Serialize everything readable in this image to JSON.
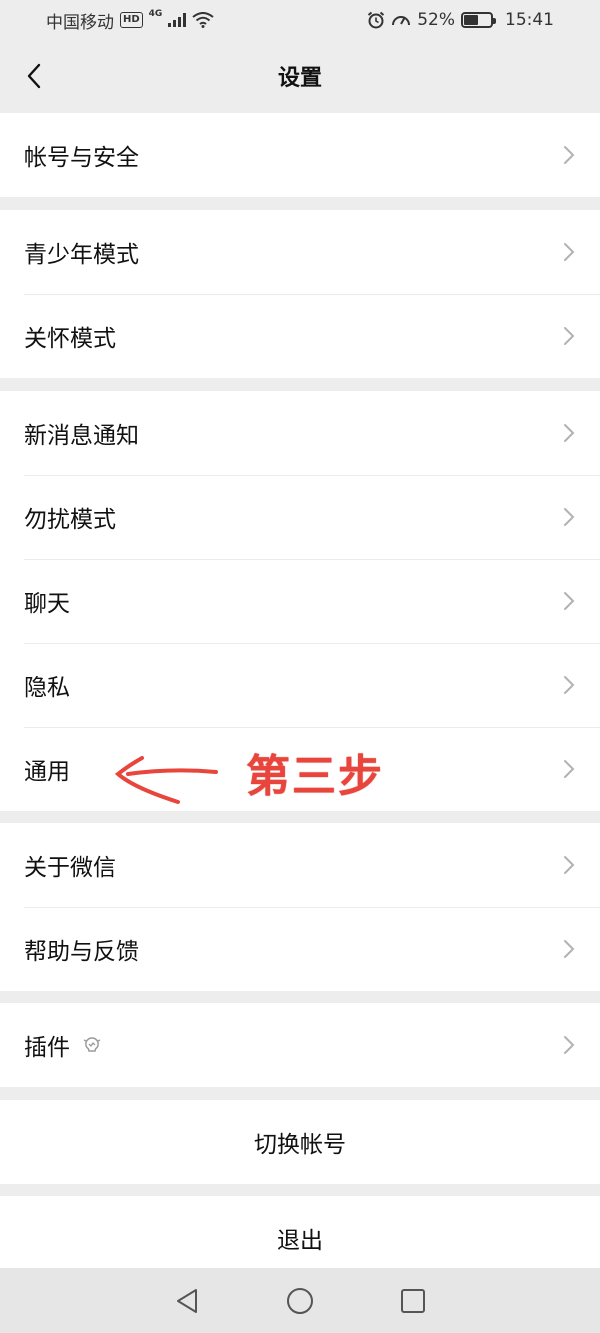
{
  "status": {
    "carrier": "中国移动",
    "hd": "HD",
    "network": "4G",
    "battery_percent_text": "52%",
    "battery_level": 0.52,
    "time": "15:41"
  },
  "nav": {
    "title": "设置"
  },
  "groups": [
    {
      "items": [
        {
          "label": "帐号与安全"
        }
      ]
    },
    {
      "items": [
        {
          "label": "青少年模式"
        },
        {
          "label": "关怀模式"
        }
      ]
    },
    {
      "items": [
        {
          "label": "新消息通知"
        },
        {
          "label": "勿扰模式"
        },
        {
          "label": "聊天"
        },
        {
          "label": "隐私"
        },
        {
          "label": "通用"
        }
      ]
    },
    {
      "items": [
        {
          "label": "关于微信"
        },
        {
          "label": "帮助与反馈"
        }
      ]
    },
    {
      "items": [
        {
          "label": "插件"
        }
      ]
    }
  ],
  "actions": {
    "switch_account": "切换帐号",
    "logout": "退出"
  },
  "annotation": {
    "text": "第三步"
  },
  "colors": {
    "background": "#ededed",
    "card": "#ffffff",
    "annotation": "#e8453c",
    "chevron": "#b2b2b2"
  },
  "icons": {
    "back": "chevron-left-icon",
    "row_arrow": "chevron-right-icon",
    "plugin": "plugin-bulb-icon"
  }
}
